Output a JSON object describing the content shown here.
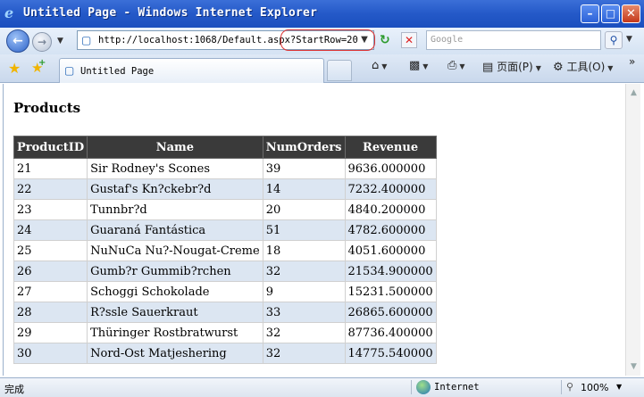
{
  "window": {
    "title": "Untitled Page - Windows Internet Explorer"
  },
  "address": {
    "url": "http://localhost:1068/Default.aspx?StartRow=20"
  },
  "search": {
    "placeholder": "Google"
  },
  "tab": {
    "label": "Untitled Page"
  },
  "commands": [
    {
      "label": "",
      "icon": "home-icon"
    },
    {
      "label": "",
      "icon": "feeds-icon"
    },
    {
      "label": "",
      "icon": "print-icon"
    },
    {
      "label": "页面(P)",
      "icon": "page-icon"
    },
    {
      "label": "工具(O)",
      "icon": "tools-icon"
    }
  ],
  "page": {
    "heading": "Products",
    "table": {
      "columns": [
        "ProductID",
        "Name",
        "NumOrders",
        "Revenue"
      ],
      "rows": [
        [
          "21",
          "Sir Rodney's Scones",
          "39",
          "9636.000000"
        ],
        [
          "22",
          "Gustaf's Kn?ckebr?d",
          "14",
          "7232.400000"
        ],
        [
          "23",
          "Tunnbr?d",
          "20",
          "4840.200000"
        ],
        [
          "24",
          "Guaraná Fantástica",
          "51",
          "4782.600000"
        ],
        [
          "25",
          "NuNuCa Nu?-Nougat-Creme",
          "18",
          "4051.600000"
        ],
        [
          "26",
          "Gumb?r Gummib?rchen",
          "32",
          "21534.900000"
        ],
        [
          "27",
          "Schoggi Schokolade",
          "9",
          "15231.500000"
        ],
        [
          "28",
          "R?ssle Sauerkraut",
          "33",
          "26865.600000"
        ],
        [
          "29",
          "Thüringer Rostbratwurst",
          "32",
          "87736.400000"
        ],
        [
          "30",
          "Nord-Ost Matjeshering",
          "32",
          "14775.540000"
        ]
      ]
    }
  },
  "status": {
    "text": "完成",
    "zone": "Internet",
    "zoom": "100%"
  },
  "colors": {
    "header_bg": "#3a3a3a",
    "alt_row": "#dce6f2",
    "title_bar": "#2459c8"
  }
}
